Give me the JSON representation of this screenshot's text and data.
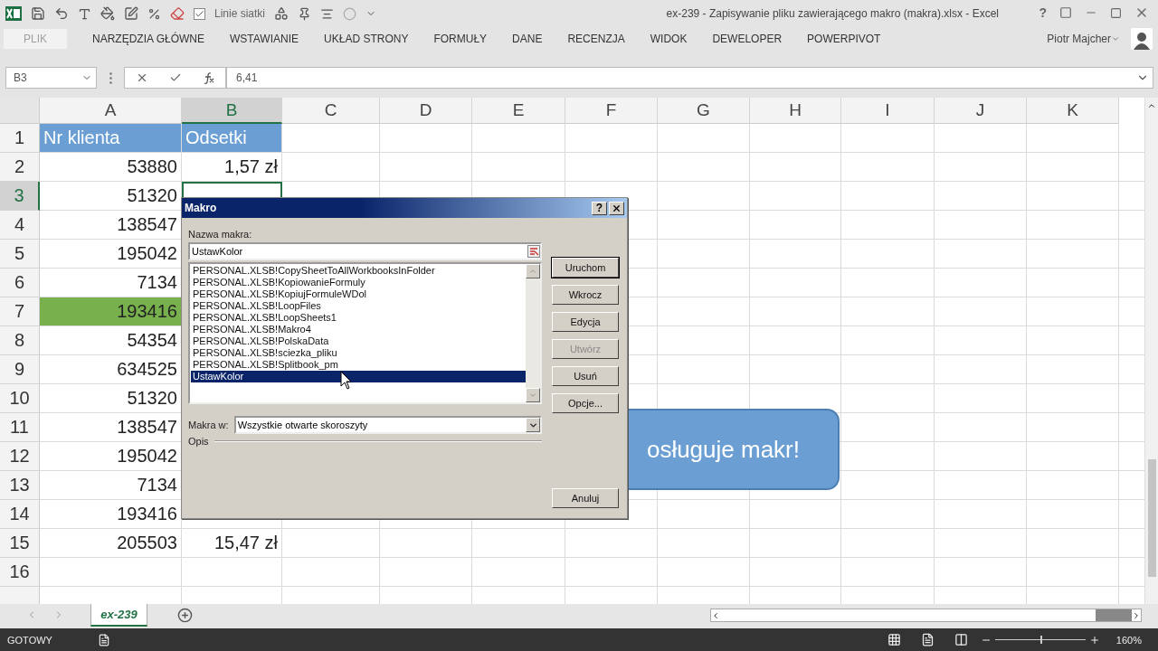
{
  "title_bar": {
    "title": "ex-239 - Zapisywanie pliku zawierającego makro (makra).xlsx - Excel",
    "help": "?"
  },
  "quick_access": {
    "gridlines_label": "Linie siatki",
    "gridlines_checked": true
  },
  "ribbon_tabs": [
    {
      "label": "PLIK",
      "kind": "file",
      "selected": false
    },
    {
      "label": "NARZĘDZIA GŁÓWNE",
      "kind": "tab",
      "selected": false
    },
    {
      "label": "WSTAWIANIE",
      "kind": "tab",
      "selected": false
    },
    {
      "label": "UKŁAD STRONY",
      "kind": "tab",
      "selected": false
    },
    {
      "label": "FORMUŁY",
      "kind": "tab",
      "selected": false
    },
    {
      "label": "DANE",
      "kind": "tab",
      "selected": false
    },
    {
      "label": "RECENZJA",
      "kind": "tab",
      "selected": false
    },
    {
      "label": "WIDOK",
      "kind": "tab",
      "selected": false
    },
    {
      "label": "DEWELOPER",
      "kind": "tab",
      "selected": false
    },
    {
      "label": "POWERPIVOT",
      "kind": "tab",
      "selected": false
    }
  ],
  "account": {
    "user": "Piotr Majcher"
  },
  "formula_bar": {
    "name_box": "B3",
    "formula": "6,41"
  },
  "sheet": {
    "columns": [
      {
        "label": "A",
        "selected": false
      },
      {
        "label": "B",
        "selected": true
      },
      {
        "label": "C",
        "selected": false
      },
      {
        "label": "D",
        "selected": false
      },
      {
        "label": "E",
        "selected": false
      },
      {
        "label": "F",
        "selected": false
      },
      {
        "label": "G",
        "selected": false
      },
      {
        "label": "H",
        "selected": false
      },
      {
        "label": "I",
        "selected": false
      },
      {
        "label": "J",
        "selected": false
      },
      {
        "label": "K",
        "selected": false
      }
    ],
    "rows": [
      {
        "label": "1",
        "selected": false,
        "cells": [
          {
            "text": "Nr klienta",
            "kind": "header"
          },
          {
            "text": "Odsetki",
            "kind": "header"
          }
        ]
      },
      {
        "label": "2",
        "selected": false,
        "cells": [
          {
            "text": "53880",
            "kind": "number"
          },
          {
            "text": "1,57 zł",
            "kind": "number"
          }
        ]
      },
      {
        "label": "3",
        "selected": true,
        "cells": [
          {
            "text": "51320",
            "kind": "number"
          }
        ]
      },
      {
        "label": "4",
        "selected": false,
        "cells": [
          {
            "text": "138547",
            "kind": "number"
          }
        ]
      },
      {
        "label": "5",
        "selected": false,
        "cells": [
          {
            "text": "195042",
            "kind": "number"
          }
        ]
      },
      {
        "label": "6",
        "selected": false,
        "cells": [
          {
            "text": "7134",
            "kind": "number"
          }
        ]
      },
      {
        "label": "7",
        "selected": false,
        "cells": [
          {
            "text": "193416",
            "kind": "green"
          }
        ]
      },
      {
        "label": "8",
        "selected": false,
        "cells": [
          {
            "text": "54354",
            "kind": "number"
          }
        ]
      },
      {
        "label": "9",
        "selected": false,
        "cells": [
          {
            "text": "634525",
            "kind": "number"
          }
        ]
      },
      {
        "label": "10",
        "selected": false,
        "cells": [
          {
            "text": "51320",
            "kind": "number"
          }
        ]
      },
      {
        "label": "11",
        "selected": false,
        "cells": [
          {
            "text": "138547",
            "kind": "number"
          }
        ]
      },
      {
        "label": "12",
        "selected": false,
        "cells": [
          {
            "text": "195042",
            "kind": "number"
          }
        ]
      },
      {
        "label": "13",
        "selected": false,
        "cells": [
          {
            "text": "7134",
            "kind": "number"
          }
        ]
      },
      {
        "label": "14",
        "selected": false,
        "cells": [
          {
            "text": "193416",
            "kind": "number"
          }
        ]
      },
      {
        "label": "15",
        "selected": false,
        "cells": [
          {
            "text": "205503",
            "kind": "number"
          },
          {
            "text": "15,47 zł",
            "kind": "number"
          }
        ]
      },
      {
        "label": "16",
        "selected": false,
        "cells": []
      }
    ]
  },
  "shape": {
    "text": "osługuje makr!"
  },
  "dialog": {
    "title": "Makro",
    "help": "?",
    "name_label": "Nazwa makra:",
    "name_value": "UstawKolor",
    "macros": [
      {
        "label": "PERSONAL.XLSB!CopySheetToAllWorkbooksInFolder",
        "selected": false
      },
      {
        "label": "PERSONAL.XLSB!KopiowanieFormuly",
        "selected": false
      },
      {
        "label": "PERSONAL.XLSB!KopiujFormuleWDol",
        "selected": false
      },
      {
        "label": "PERSONAL.XLSB!LoopFiles",
        "selected": false
      },
      {
        "label": "PERSONAL.XLSB!LoopSheets1",
        "selected": false
      },
      {
        "label": "PERSONAL.XLSB!Makro4",
        "selected": false
      },
      {
        "label": "PERSONAL.XLSB!PolskaData",
        "selected": false
      },
      {
        "label": "PERSONAL.XLSB!sciezka_pliku",
        "selected": false
      },
      {
        "label": "PERSONAL.XLSB!Splitbook_pm",
        "selected": false
      },
      {
        "label": "UstawKolor",
        "selected": true
      }
    ],
    "location_label": "Makra w:",
    "location_value": "Wszystkie otwarte skoroszyty",
    "description_label": "Opis",
    "buttons": [
      {
        "label": "Uruchom",
        "disabled": false
      },
      {
        "label": "Wkrocz",
        "disabled": false
      },
      {
        "label": "Edycja",
        "disabled": false
      },
      {
        "label": "Utwórz",
        "disabled": true
      },
      {
        "label": "Usuń",
        "disabled": false
      },
      {
        "label": "Opcje...",
        "disabled": false
      }
    ],
    "cancel": "Anuluj"
  },
  "sheet_tabs": [
    {
      "label": "ex-239",
      "selected": true
    }
  ],
  "status_bar": {
    "status": "GOTOWY",
    "zoom": "160%",
    "zoom_slider": {
      "level": 0.5
    }
  }
}
